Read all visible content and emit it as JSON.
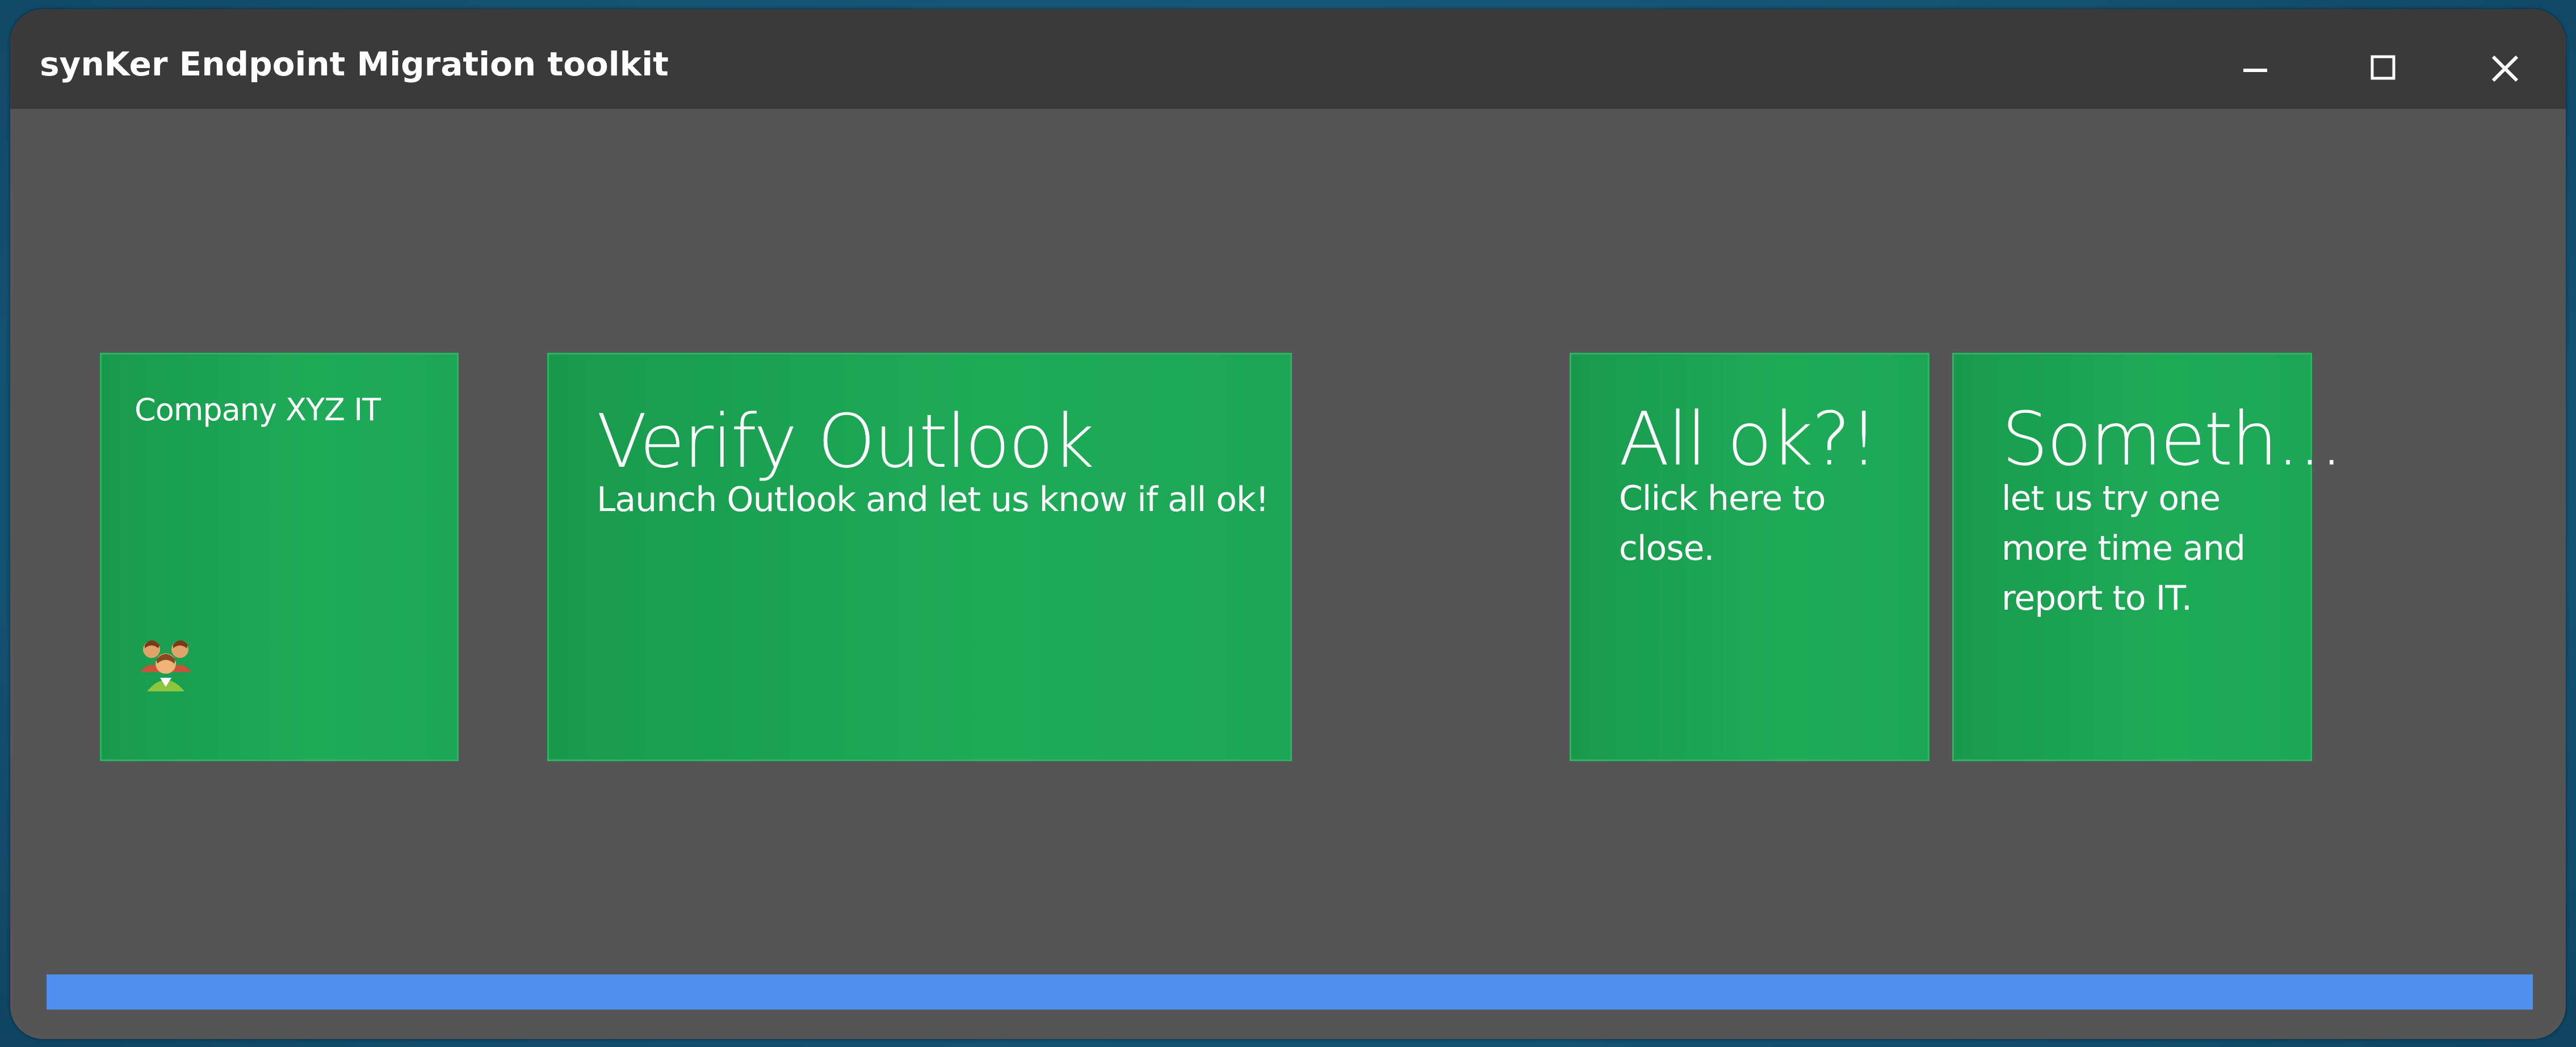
{
  "window": {
    "title": "synKer Endpoint Migration toolkit",
    "controls": [
      "minimize-icon",
      "maximize-icon",
      "close-icon"
    ]
  },
  "tiles": [
    {
      "id": "company",
      "title": "Company XYZ IT",
      "icon": "users-group-icon"
    },
    {
      "id": "verify",
      "title": "Verify Outlook",
      "description": "Launch Outlook and let us know if all ok!"
    },
    {
      "id": "allok",
      "title": "All ok?!",
      "description_lines": [
        "Click here to",
        "close."
      ]
    },
    {
      "id": "someth",
      "title": "Someth...",
      "description_lines": [
        "let us try one",
        "more time and",
        "report to IT."
      ]
    }
  ],
  "progress": {
    "percent": 100
  },
  "colors": {
    "tile_green": "#1ca656",
    "window_bg": "#555555",
    "titlebar_bg": "#3a3a3a",
    "progress_fill": "#4f8ff0",
    "desktop_bg": "#17577a"
  }
}
